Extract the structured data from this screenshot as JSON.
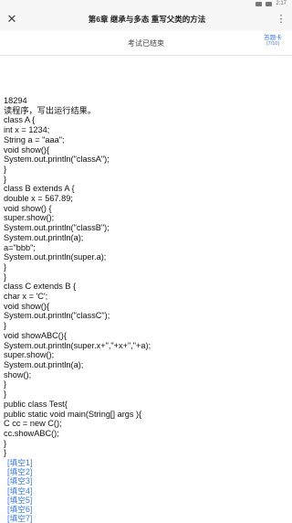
{
  "statusbar": {
    "time": "2:17"
  },
  "header": {
    "title": "第6章 继承与多态 重写父类的方法"
  },
  "exam": {
    "status": "考试已结束",
    "answer_card_label": "答题卡",
    "answer_card_progress": "(7/10)"
  },
  "question": {
    "id": "18294",
    "prompt": "读程序，写出运行结果。",
    "code_lines": [
      "class A {",
      "int x = 1234;",
      "String a = \"aaa\";",
      "void show(){",
      "System.out.println(\"classA\");",
      "}",
      "}",
      "class B extends A {",
      "double x = 567.89;",
      "void show() {",
      "super.show();",
      "System.out.println(\"classB\");",
      "System.out.println(a);",
      "a=\"bbb\";",
      "System.out.println(super.a);",
      "}",
      "}",
      "class C extends B {",
      "char x = 'C';",
      "void show(){",
      "System.out.println(\"classC\");",
      "}",
      "void showABC(){",
      "System.out.println(super.x+\",\"+x+\",\"+a);",
      "super.show();",
      "System.out.println(a);",
      "show();",
      "}",
      "}",
      "public class Test{",
      "public static void main(String[] args ){",
      "C cc = new C();",
      "cc.showABC();",
      "}",
      "}"
    ],
    "blanks": [
      "[填空1]",
      "[填空2]",
      "[填空3]",
      "[填空4]",
      "[填空5]",
      "[填空6]",
      "[填空7]"
    ]
  }
}
